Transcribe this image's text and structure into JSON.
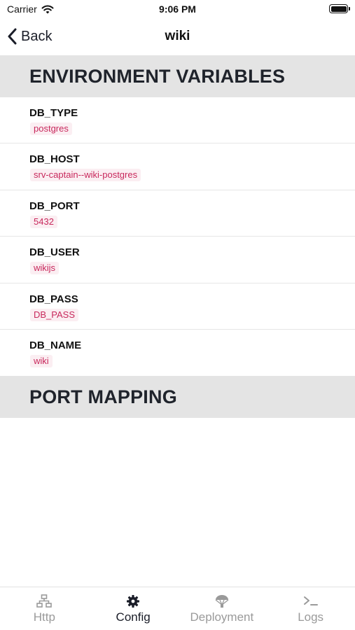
{
  "status_bar": {
    "carrier": "Carrier",
    "time": "9:06 PM"
  },
  "nav": {
    "back_label": "Back",
    "title": "wiki"
  },
  "sections": {
    "env_title": "ENVIRONMENT VARIABLES",
    "port_title": "PORT MAPPING"
  },
  "env_vars": [
    {
      "key": "DB_TYPE",
      "value": "postgres"
    },
    {
      "key": "DB_HOST",
      "value": "srv-captain--wiki-postgres"
    },
    {
      "key": "DB_PORT",
      "value": "5432"
    },
    {
      "key": "DB_USER",
      "value": "wikijs"
    },
    {
      "key": "DB_PASS",
      "value": "DB_PASS"
    },
    {
      "key": "DB_NAME",
      "value": "wiki"
    }
  ],
  "tabs": [
    {
      "label": "Http",
      "icon": "network-icon",
      "active": false
    },
    {
      "label": "Config",
      "icon": "gear-icon",
      "active": true
    },
    {
      "label": "Deployment",
      "icon": "parachute-icon",
      "active": false
    },
    {
      "label": "Logs",
      "icon": "terminal-icon",
      "active": false
    }
  ],
  "colors": {
    "accent": "#1a1d28",
    "inactive": "#9a9a9a",
    "value_text": "#c8285c",
    "value_bg": "#fbeef2",
    "section_bg": "#e4e4e4"
  }
}
